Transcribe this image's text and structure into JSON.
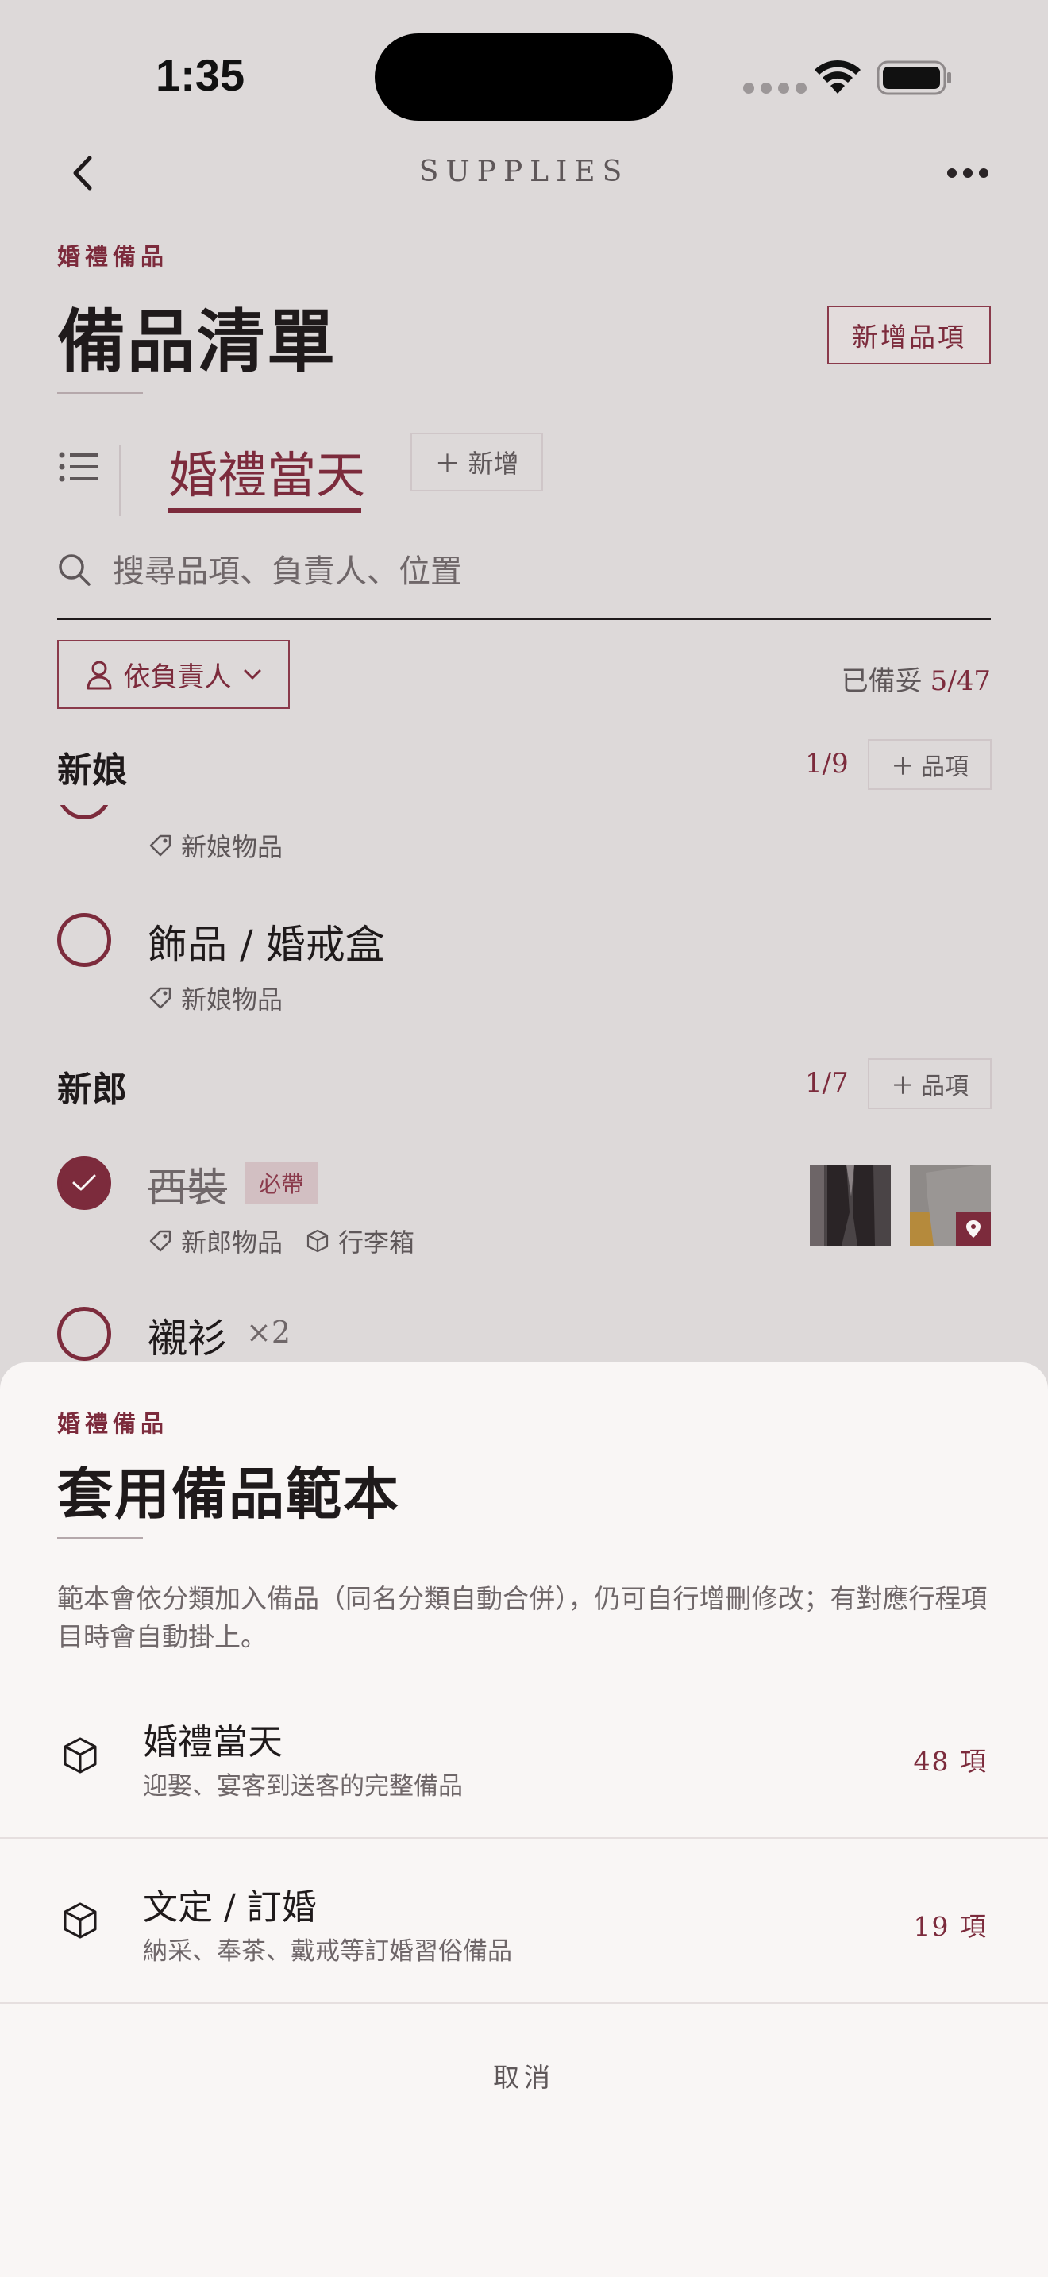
{
  "status": {
    "time": "1:35"
  },
  "header": {
    "title": "SUPPLIES"
  },
  "page": {
    "eyebrow": "婚禮備品",
    "title": "備品清單",
    "add_item_label": "新增品項"
  },
  "tabs": {
    "active": "婚禮當天",
    "add_label": "新增"
  },
  "search": {
    "placeholder": "搜尋品項、負責人、位置"
  },
  "filter": {
    "label": "依負責人",
    "ready_label": "已備妥",
    "ready_value": "5/47"
  },
  "sections": [
    {
      "title": "新娘",
      "count": "1/9",
      "add_label": "品項",
      "items": [
        {
          "tag": "新娘物品"
        },
        {
          "name": "飾品 / 婚戒盒",
          "tag": "新娘物品"
        }
      ]
    },
    {
      "title": "新郎",
      "count": "1/7",
      "add_label": "品項",
      "items": [
        {
          "name": "西裝",
          "badge": "必帶",
          "tag": "新郎物品",
          "location": "行李箱"
        },
        {
          "name": "襯衫",
          "qty": "×2"
        }
      ]
    }
  ],
  "sheet": {
    "eyebrow": "婚禮備品",
    "title": "套用備品範本",
    "description": "範本會依分類加入備品（同名分類自動合併），仍可自行增刪修改；有對應行程項目時會自動掛上。",
    "templates": [
      {
        "name": "婚禮當天",
        "subtitle": "迎娶、宴客到送客的完整備品",
        "count": "48 項"
      },
      {
        "name": "文定 / 訂婚",
        "subtitle": "納采、奉茶、戴戒等訂婚習俗備品",
        "count": "19 項"
      }
    ],
    "cancel_label": "取消"
  },
  "colors": {
    "accent": "#7c2b3c",
    "background": "#ddd9d9",
    "sheet": "#f9f6f5"
  },
  "icons": [
    "back-icon",
    "more-icon",
    "list-icon",
    "plus-icon",
    "search-icon",
    "person-icon",
    "chevron-down-icon",
    "tag-icon",
    "box-icon",
    "check-icon",
    "location-pin-icon",
    "wifi-icon",
    "battery-icon"
  ]
}
